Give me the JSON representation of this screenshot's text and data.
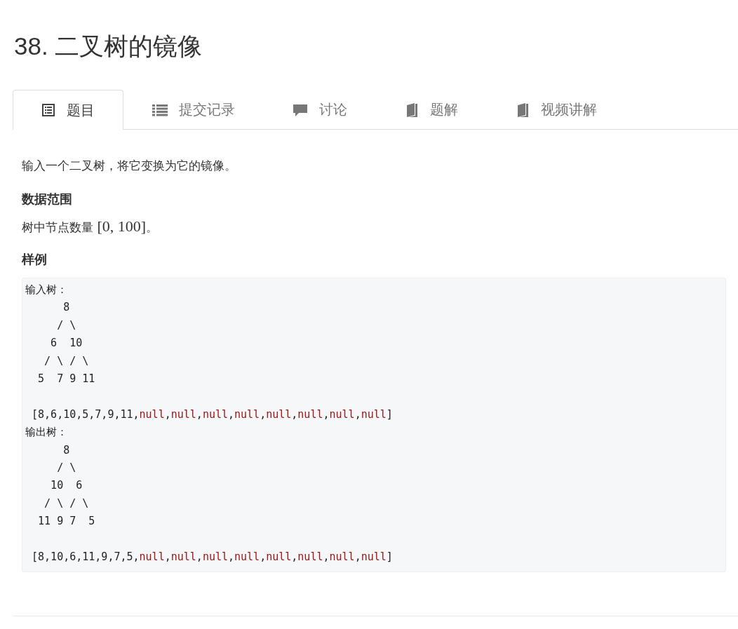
{
  "title": "38. 二叉树的镜像",
  "tabs": [
    {
      "label": "题目",
      "kind": "doc",
      "selected": true
    },
    {
      "label": "提交记录",
      "kind": "list",
      "selected": false
    },
    {
      "label": "讨论",
      "kind": "chat",
      "selected": false
    },
    {
      "label": "题解",
      "kind": "book",
      "selected": false
    },
    {
      "label": "视频讲解",
      "kind": "book",
      "selected": false
    }
  ],
  "description": "输入一个二叉树，将它变换为它的镜像。",
  "sections": [
    {
      "heading": "数据范围",
      "text": "树中节点数量",
      "math": "[0, 100]",
      "end": "。"
    }
  ],
  "example_heading": "样例",
  "code_lines": [
    {
      "segments": [
        {
          "text": "输入树：",
          "kind": "label"
        }
      ]
    },
    {
      "segments": [
        {
          "text": "      8",
          "kind": "plain"
        }
      ]
    },
    {
      "segments": [
        {
          "text": "     / \\",
          "kind": "plain"
        }
      ]
    },
    {
      "segments": [
        {
          "text": "    6  10",
          "kind": "plain"
        }
      ]
    },
    {
      "segments": [
        {
          "text": "   / \\ / \\",
          "kind": "plain"
        }
      ]
    },
    {
      "segments": [
        {
          "text": "  5  7 9 11",
          "kind": "plain"
        }
      ]
    },
    {
      "kind": "blank"
    },
    {
      "segments": [
        {
          "text": " [8,6,10,5,7,9,11,",
          "kind": "plain"
        },
        {
          "text": "null",
          "kind": "keyword"
        },
        {
          "text": ",",
          "kind": "plain"
        },
        {
          "text": "null",
          "kind": "keyword"
        },
        {
          "text": ",",
          "kind": "plain"
        },
        {
          "text": "null",
          "kind": "keyword"
        },
        {
          "text": ",",
          "kind": "plain"
        },
        {
          "text": "null",
          "kind": "keyword"
        },
        {
          "text": ",",
          "kind": "plain"
        },
        {
          "text": "null",
          "kind": "keyword"
        },
        {
          "text": ",",
          "kind": "plain"
        },
        {
          "text": "null",
          "kind": "keyword"
        },
        {
          "text": ",",
          "kind": "plain"
        },
        {
          "text": "null",
          "kind": "keyword"
        },
        {
          "text": ",",
          "kind": "plain"
        },
        {
          "text": "null",
          "kind": "keyword"
        },
        {
          "text": "]",
          "kind": "plain"
        }
      ]
    },
    {
      "segments": [
        {
          "text": "输出树：",
          "kind": "label"
        }
      ]
    },
    {
      "segments": [
        {
          "text": "      8",
          "kind": "plain"
        }
      ]
    },
    {
      "segments": [
        {
          "text": "     / \\",
          "kind": "plain"
        }
      ]
    },
    {
      "segments": [
        {
          "text": "    10  6",
          "kind": "plain"
        }
      ]
    },
    {
      "segments": [
        {
          "text": "   / \\ / \\",
          "kind": "plain"
        }
      ]
    },
    {
      "segments": [
        {
          "text": "  11 9 7  5",
          "kind": "plain"
        }
      ]
    },
    {
      "kind": "blank"
    },
    {
      "segments": [
        {
          "text": " [8,10,6,11,9,7,5,",
          "kind": "plain"
        },
        {
          "text": "null",
          "kind": "keyword"
        },
        {
          "text": ",",
          "kind": "plain"
        },
        {
          "text": "null",
          "kind": "keyword"
        },
        {
          "text": ",",
          "kind": "plain"
        },
        {
          "text": "null",
          "kind": "keyword"
        },
        {
          "text": ",",
          "kind": "plain"
        },
        {
          "text": "null",
          "kind": "keyword"
        },
        {
          "text": ",",
          "kind": "plain"
        },
        {
          "text": "null",
          "kind": "keyword"
        },
        {
          "text": ",",
          "kind": "plain"
        },
        {
          "text": "null",
          "kind": "keyword"
        },
        {
          "text": ",",
          "kind": "plain"
        },
        {
          "text": "null",
          "kind": "keyword"
        },
        {
          "text": ",",
          "kind": "plain"
        },
        {
          "text": "null",
          "kind": "keyword"
        },
        {
          "text": "]",
          "kind": "plain"
        }
      ]
    }
  ]
}
